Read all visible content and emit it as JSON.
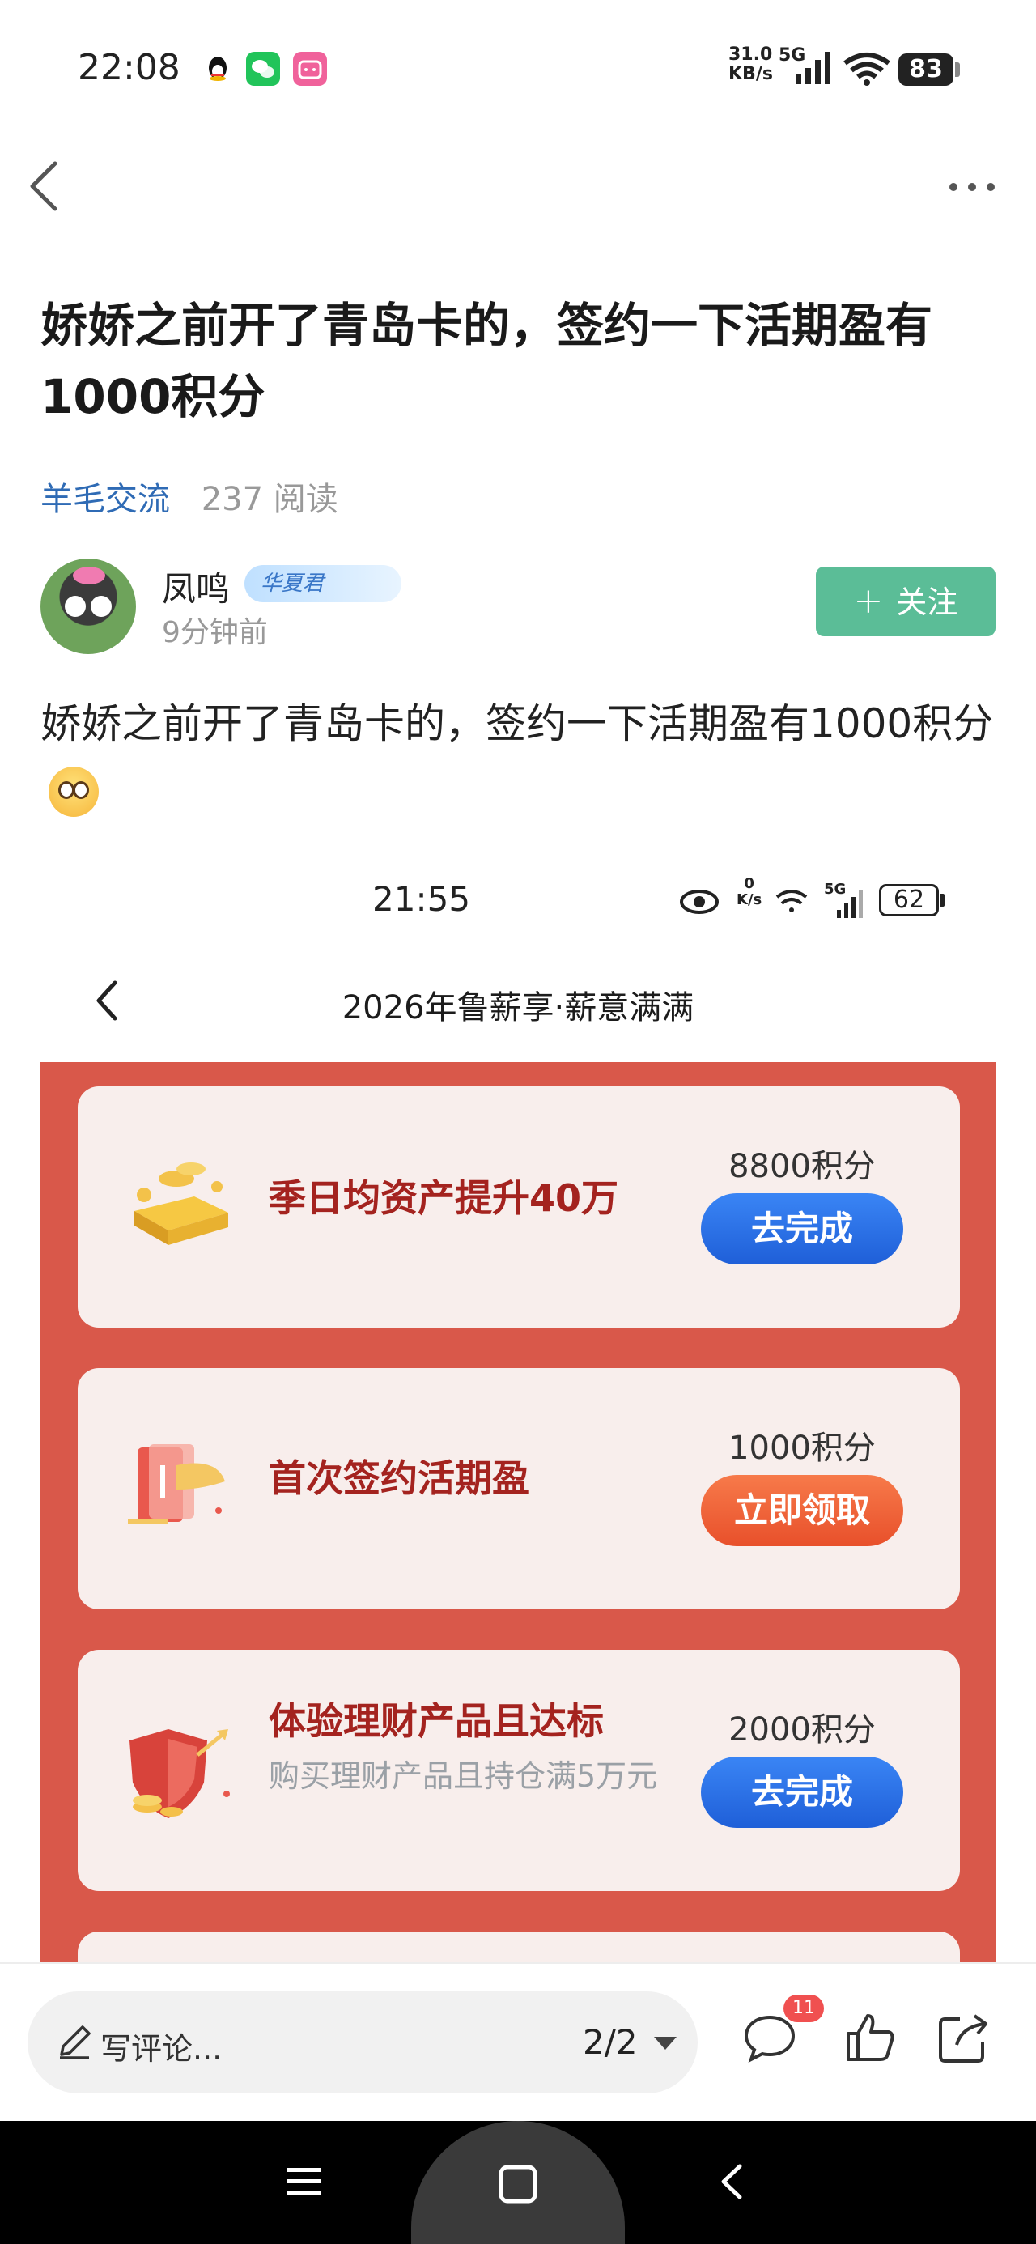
{
  "status_bar": {
    "time": "22:08",
    "net_speed_value": "31.0",
    "net_speed_unit": "KB/s",
    "network": "5G",
    "battery": "83",
    "apps": [
      "qq-icon",
      "wechat-icon",
      "bilibili-icon"
    ]
  },
  "post": {
    "title": "娇娇之前开了青岛卡的，签约一下活期盈有1000积分",
    "tag": "羊毛交流",
    "reads": "237 阅读",
    "author": {
      "name": "凤鸣",
      "badge": "华夏君",
      "time": "9分钟前"
    },
    "follow_label": "关注",
    "body": "娇娇之前开了青岛卡的，签约一下活期盈有1000积分"
  },
  "screenshot": {
    "time": "21:55",
    "net_speed_value": "0",
    "net_speed_unit": "K/s",
    "network": "5G",
    "battery": "62",
    "title": "2026年鲁薪享·薪意满满",
    "tasks": [
      {
        "title": "季日均资产提升40万",
        "subtitle": "",
        "points": "8800积分",
        "action": "去完成",
        "action_color": "#2a6fe6",
        "icon": "gold-bars-icon"
      },
      {
        "title": "首次签约活期盈",
        "subtitle": "",
        "points": "1000积分",
        "action": "立即领取",
        "action_color": "#ee6236",
        "icon": "contract-icon"
      },
      {
        "title": "体验理财产品且达标",
        "subtitle": "购买理财产品且持仓满5万元",
        "points": "2000积分",
        "action": "去完成",
        "action_color": "#2a6fe6",
        "icon": "shield-coins-icon"
      }
    ]
  },
  "bottom_bar": {
    "comment_placeholder": "写评论...",
    "page": "2/2",
    "comment_count": "11"
  },
  "colors": {
    "follow": "#5bbd97",
    "tag": "#2f6bb5",
    "red_panel": "#d9584a",
    "card_title": "#a4231f"
  }
}
